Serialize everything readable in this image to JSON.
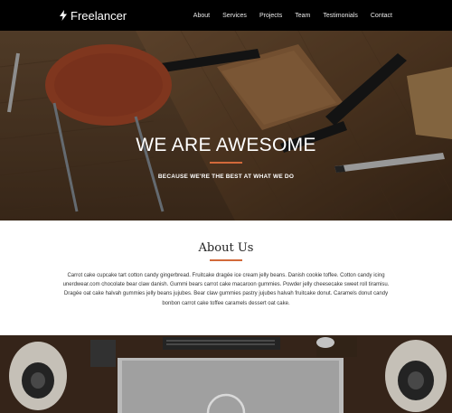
{
  "nav": {
    "brand": "Freelancer",
    "brand_icon": "lightning-bolt-icon",
    "links": [
      "About",
      "Services",
      "Projects",
      "Team",
      "Testimonials",
      "Contact"
    ]
  },
  "hero": {
    "title": "WE ARE AWESOME",
    "subtitle": "BECAUSE WE'RE THE BEST AT WHAT WE DO",
    "accent_color": "#d2693a"
  },
  "about": {
    "title": "About Us",
    "body": "Carrot cake cupcake tart cotton candy gingerbread. Fruitcake dragée ice cream jelly beans. Danish cookie toffee. Cotton candy icing unerdwear.com chocolate bear claw danish. Gummi bears carrot cake macaroon gummies. Powder jelly cheesecake sweet roll tiramisu. Dragée oat cake halvah gummies jelly beans jujubes. Bear claw gummies pastry jujubes halvah fruitcake donut. Caramels donut candy bonbon carrot cake toffee caramels dessert oat cake."
  }
}
